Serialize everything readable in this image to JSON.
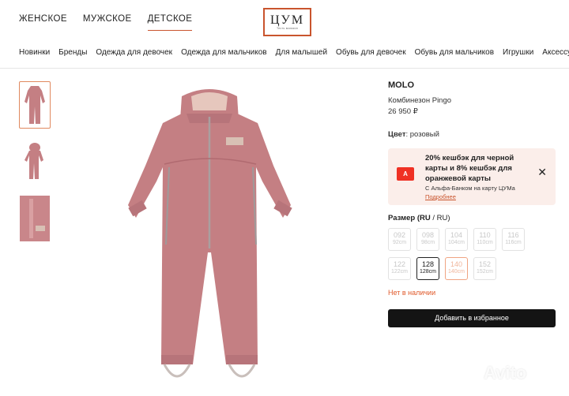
{
  "top_tabs": [
    "ЖЕНСКОЕ",
    "МУЖСКОЕ",
    "ДЕТСКОЕ"
  ],
  "logo": {
    "main": "ЦУМ",
    "sub": "Тесть магазин"
  },
  "nav": [
    "Новинки",
    "Бренды",
    "Одежда для девочек",
    "Одежда для мальчиков",
    "Для малышей",
    "Обувь для девочек",
    "Обувь для мальчиков",
    "Игрушки",
    "Аксессуары"
  ],
  "product": {
    "brand": "MOLO",
    "name": "Комбинезон Pingo",
    "price": "26 950 ₽",
    "color_label": "Цвет",
    "color_value": ": розовый",
    "main_color": "#c47f83"
  },
  "promo": {
    "badge": "А",
    "title": "20% кешбэк для черной карты и 8% кешбэк для оранжевой карты",
    "subtitle": "С Альфа-Банком на карту ЦУМа",
    "link": "Подробнее"
  },
  "size_section": {
    "title_bold": "Размер (RU",
    "title_rest": " / RU)"
  },
  "sizes": [
    {
      "ru": "092",
      "cm": "92cm",
      "state": "unavailable"
    },
    {
      "ru": "098",
      "cm": "98cm",
      "state": "unavailable"
    },
    {
      "ru": "104",
      "cm": "104cm",
      "state": "unavailable"
    },
    {
      "ru": "110",
      "cm": "110cm",
      "state": "unavailable"
    },
    {
      "ru": "116",
      "cm": "116cm",
      "state": "unavailable"
    },
    {
      "ru": "122",
      "cm": "122cm",
      "state": "unavailable"
    },
    {
      "ru": "128",
      "cm": "128cm",
      "state": "available"
    },
    {
      "ru": "140",
      "cm": "140cm",
      "state": "orange"
    },
    {
      "ru": "152",
      "cm": "152cm",
      "state": "unavailable"
    }
  ],
  "stock_text": "Нет в наличии",
  "favorite_button": "Добавить в избранное",
  "watermark": "Avito"
}
